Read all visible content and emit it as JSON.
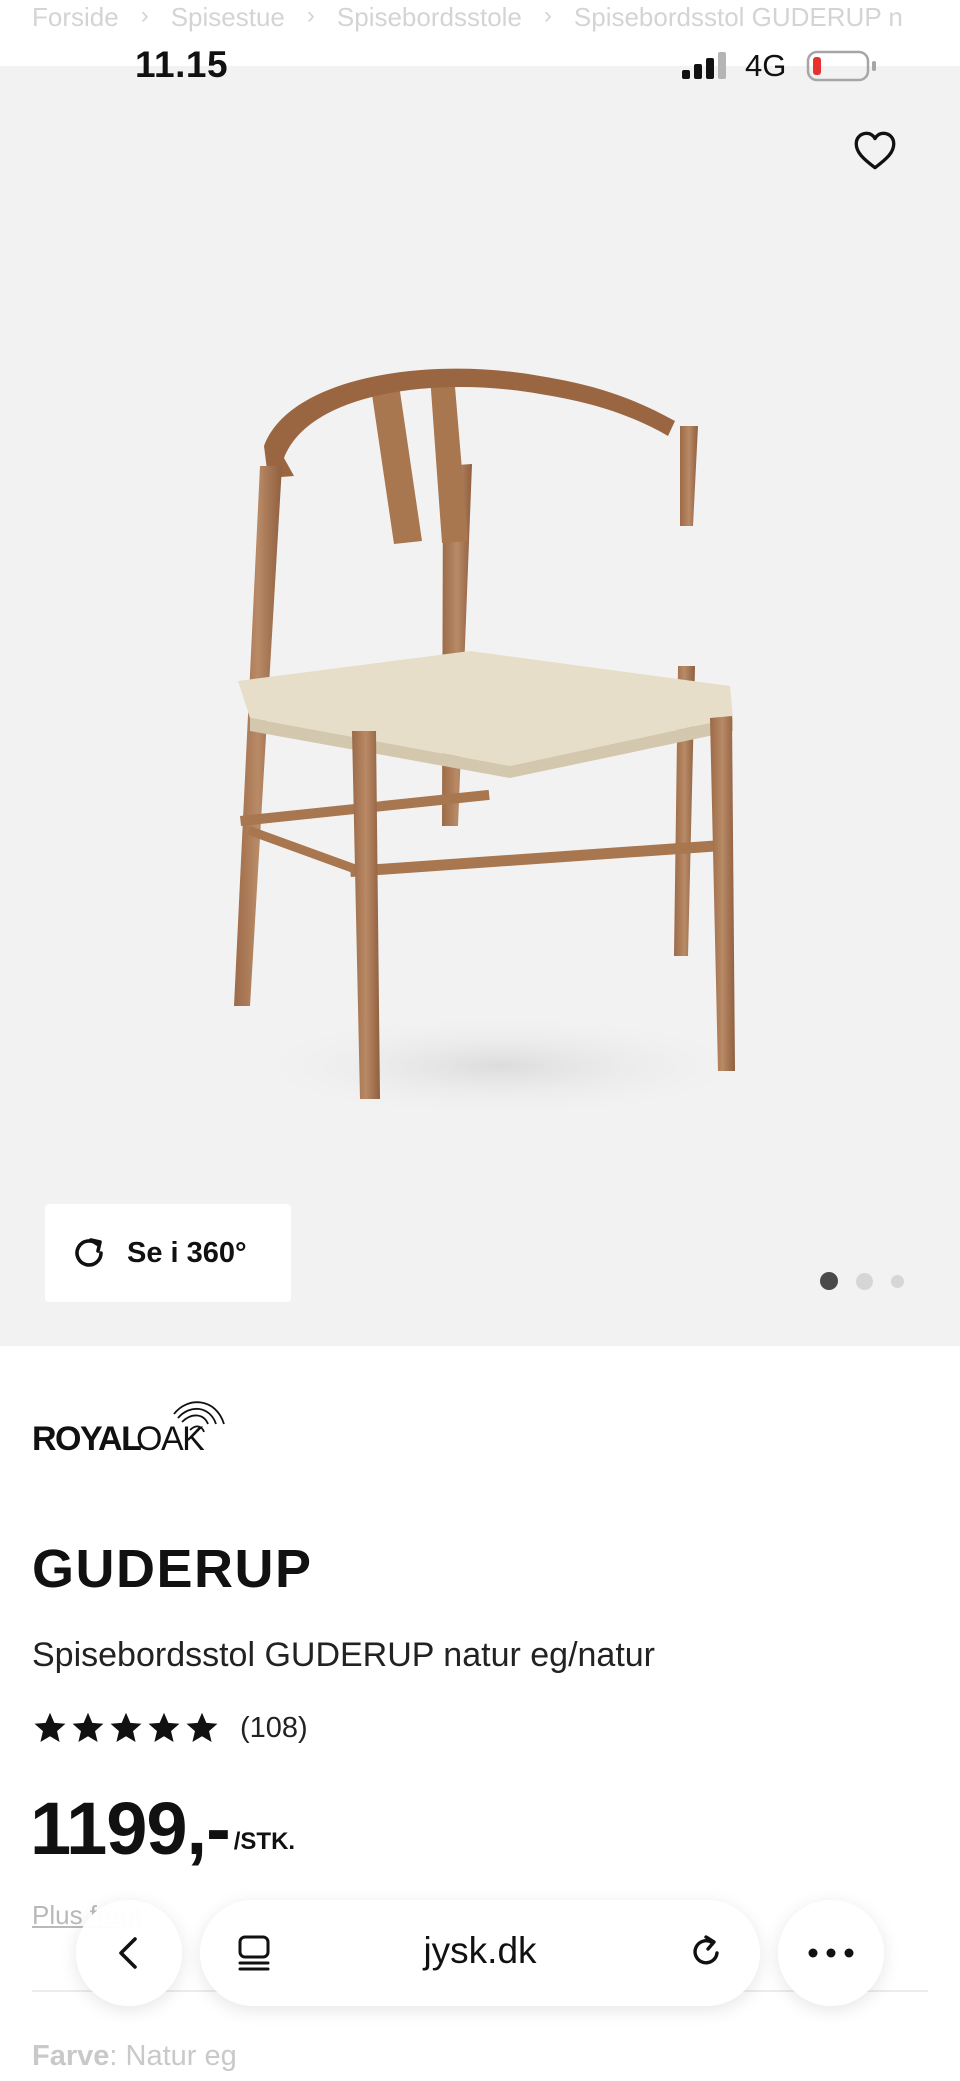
{
  "breadcrumb": {
    "items": [
      "Forside",
      "Spisestue",
      "Spisebordsstole",
      "Spisebordsstol GUDERUP n"
    ]
  },
  "status_bar": {
    "time": "11.15",
    "network": "4G",
    "battery_color": "#e5312f"
  },
  "gallery": {
    "view360_label": "Se i 360°",
    "slide_count": 3,
    "active_slide": 1,
    "background": "#f3f2f2"
  },
  "product": {
    "brand": "ROYALOAK",
    "name": "GUDERUP",
    "subtitle": "Spisebordsstol GUDERUP natur eg/natur",
    "rating_stars": 5,
    "review_count": "(108)",
    "price": "1199,-",
    "price_unit": "/STK.",
    "shipping_text": "Plus fragt",
    "color_label": "Farve",
    "color_separator": ":",
    "color_value": "Natur eg"
  },
  "browser": {
    "domain": "jysk.dk"
  },
  "icons": {
    "wishlist": "heart-icon",
    "view360": "rotate-icon",
    "back": "chevron-left-icon",
    "tabs": "tabs-icon",
    "reload": "reload-icon",
    "more": "ellipsis-icon"
  }
}
